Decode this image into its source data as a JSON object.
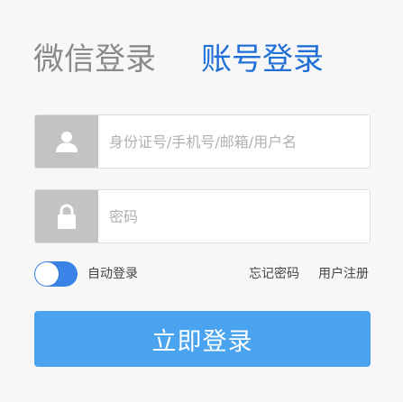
{
  "tabs": {
    "wechat_label": "微信登录",
    "account_label": "账号登录",
    "active": "account"
  },
  "fields": {
    "username": {
      "value": "",
      "placeholder": "身份证号/手机号/邮箱/用户名",
      "icon": "user-icon"
    },
    "password": {
      "value": "",
      "placeholder": "密码",
      "icon": "lock-icon"
    }
  },
  "options": {
    "auto_login_label": "自动登录",
    "auto_login_on": true,
    "forgot_password_label": "忘记密码",
    "register_label": "用户注册"
  },
  "submit_label": "立即登录",
  "colors": {
    "accent": "#1f6fd6",
    "button": "#4aa3ee",
    "toggle": "#3a84e8",
    "icon_box": "#c3c3c3",
    "inactive_tab": "#8a8a8a"
  }
}
